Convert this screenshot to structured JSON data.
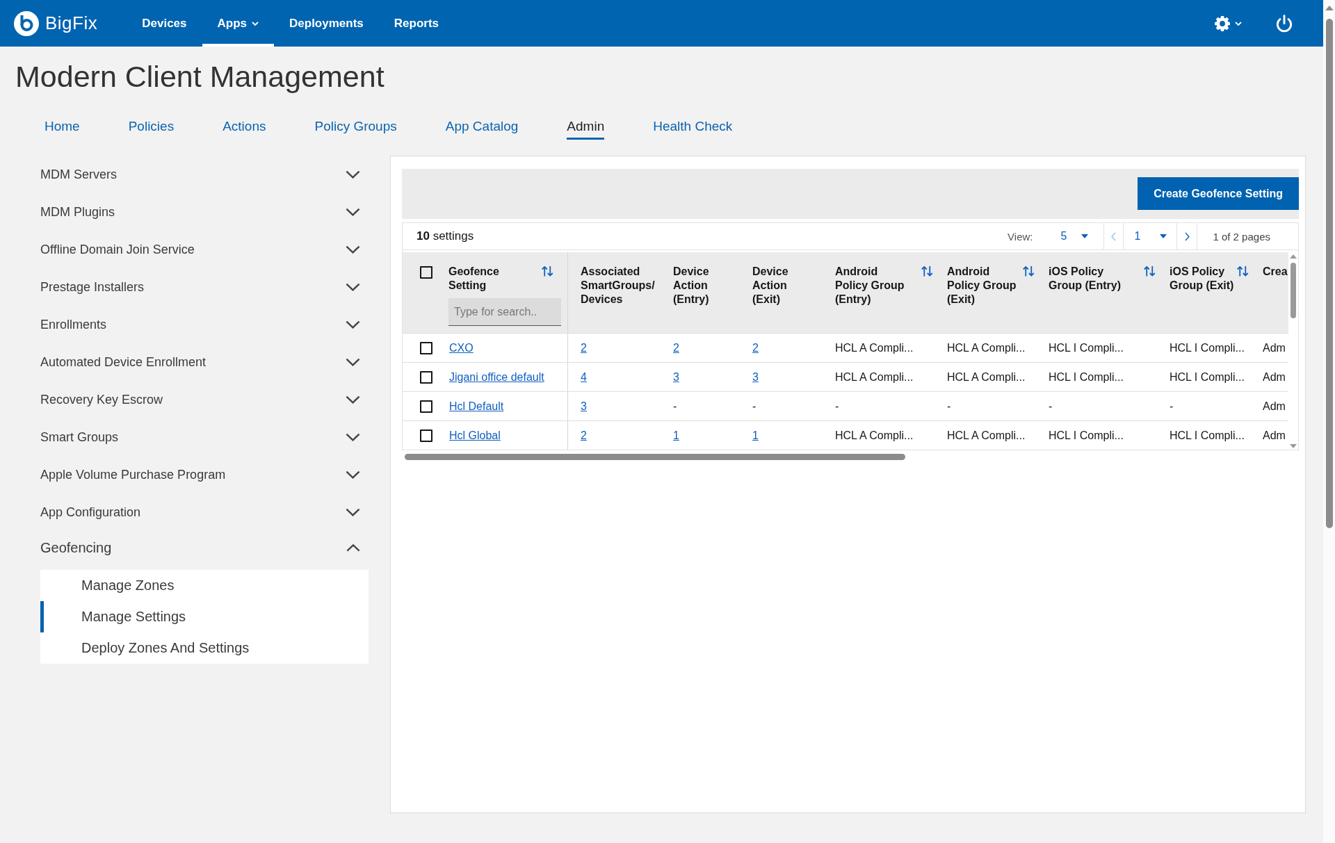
{
  "top_bar": {
    "brand": "BigFix",
    "nav": [
      {
        "label": "Devices",
        "selected": false,
        "has_menu": false
      },
      {
        "label": "Apps",
        "selected": true,
        "has_menu": true
      },
      {
        "label": "Deployments",
        "selected": false,
        "has_menu": false
      },
      {
        "label": "Reports",
        "selected": false,
        "has_menu": false
      }
    ]
  },
  "page_title": "Modern Client Management",
  "tabs": [
    {
      "label": "Home",
      "selected": false
    },
    {
      "label": "Policies",
      "selected": false
    },
    {
      "label": "Actions",
      "selected": false
    },
    {
      "label": "Policy Groups",
      "selected": false
    },
    {
      "label": "App Catalog",
      "selected": false
    },
    {
      "label": "Admin",
      "selected": true
    },
    {
      "label": "Health Check",
      "selected": false
    }
  ],
  "sidebar": {
    "items": [
      {
        "label": "MDM Servers",
        "expanded": false
      },
      {
        "label": "MDM Plugins",
        "expanded": false
      },
      {
        "label": "Offline Domain Join Service",
        "expanded": false
      },
      {
        "label": "Prestage Installers",
        "expanded": false
      },
      {
        "label": "Enrollments",
        "expanded": false
      },
      {
        "label": "Automated Device Enrollment",
        "expanded": false
      },
      {
        "label": "Recovery Key Escrow",
        "expanded": false
      },
      {
        "label": "Smart Groups",
        "expanded": false
      },
      {
        "label": "Apple Volume Purchase Program",
        "expanded": false
      },
      {
        "label": "App Configuration",
        "expanded": false
      },
      {
        "label": "Geofencing",
        "expanded": true,
        "children": [
          {
            "label": "Manage Zones",
            "selected": false
          },
          {
            "label": "Manage Settings",
            "selected": true
          },
          {
            "label": "Deploy Zones And Settings",
            "selected": false
          }
        ]
      }
    ]
  },
  "panel": {
    "create_button": "Create Geofence Setting",
    "summary": "**10** settings",
    "pagination": {
      "view_label": "View:",
      "page_size": "5",
      "page": "1",
      "page_info": "1 of 2 pages",
      "previous": {
        "disabled": true
      },
      "next": {
        "disabled": false
      }
    },
    "table": {
      "select_all": {
        "checked": false
      },
      "columns": [
        {
          "label": "Geofence Setting",
          "sortable": true,
          "search": {
            "placeholder": "Type for search.."
          }
        },
        {
          "label": "Associated SmartGroups/ Devices",
          "sortable": false
        },
        {
          "label": "Device Action (Entry)",
          "sortable": false
        },
        {
          "label": "Device Action (Exit)",
          "sortable": false
        },
        {
          "label": "Android Policy Group (Entry)",
          "sortable": true
        },
        {
          "label": "Android Policy Group (Exit)",
          "sortable": true
        },
        {
          "label": "iOS Policy Group (Entry)",
          "sortable": true
        },
        {
          "label": "iOS Policy Group (Exit)",
          "sortable": true
        },
        {
          "label": "Crea",
          "sortable": false
        }
      ],
      "rows": [
        {
          "checked": false,
          "cells": [
            {
              "text": "CXO",
              "kind": "link"
            },
            {
              "text": "2",
              "kind": "link"
            },
            {
              "text": "2",
              "kind": "link"
            },
            {
              "text": "2",
              "kind": "link"
            },
            {
              "text": "HCL A Compli...",
              "kind": "text"
            },
            {
              "text": "HCL A Compli...",
              "kind": "text"
            },
            {
              "text": "HCL I Compli...",
              "kind": "text"
            },
            {
              "text": "HCL I Compli...",
              "kind": "text"
            },
            {
              "text": "Adm",
              "kind": "text"
            }
          ]
        },
        {
          "checked": false,
          "cells": [
            {
              "text": "Jigani office default",
              "kind": "link"
            },
            {
              "text": "4",
              "kind": "link"
            },
            {
              "text": "3",
              "kind": "link"
            },
            {
              "text": "3",
              "kind": "link"
            },
            {
              "text": "HCL A Compli...",
              "kind": "text"
            },
            {
              "text": "HCL A Compli...",
              "kind": "text"
            },
            {
              "text": "HCL I Compli...",
              "kind": "text"
            },
            {
              "text": "HCL I Compli...",
              "kind": "text"
            },
            {
              "text": "Adm",
              "kind": "text"
            }
          ]
        },
        {
          "checked": false,
          "cells": [
            {
              "text": "Hcl Default",
              "kind": "link"
            },
            {
              "text": "3",
              "kind": "link"
            },
            {
              "text": "-",
              "kind": "text"
            },
            {
              "text": "-",
              "kind": "text"
            },
            {
              "text": "-",
              "kind": "text"
            },
            {
              "text": "-",
              "kind": "text"
            },
            {
              "text": "-",
              "kind": "text"
            },
            {
              "text": "-",
              "kind": "text"
            },
            {
              "text": "Adm",
              "kind": "text"
            }
          ]
        },
        {
          "checked": false,
          "cells": [
            {
              "text": "Hcl Global",
              "kind": "link"
            },
            {
              "text": "2",
              "kind": "link"
            },
            {
              "text": "1",
              "kind": "link"
            },
            {
              "text": "1",
              "kind": "link"
            },
            {
              "text": "HCL A Compli...",
              "kind": "text"
            },
            {
              "text": "HCL A Compli...",
              "kind": "text"
            },
            {
              "text": "HCL I Compli...",
              "kind": "text"
            },
            {
              "text": "HCL I Compli...",
              "kind": "text"
            },
            {
              "text": "Adm",
              "kind": "text"
            }
          ]
        }
      ]
    }
  }
}
